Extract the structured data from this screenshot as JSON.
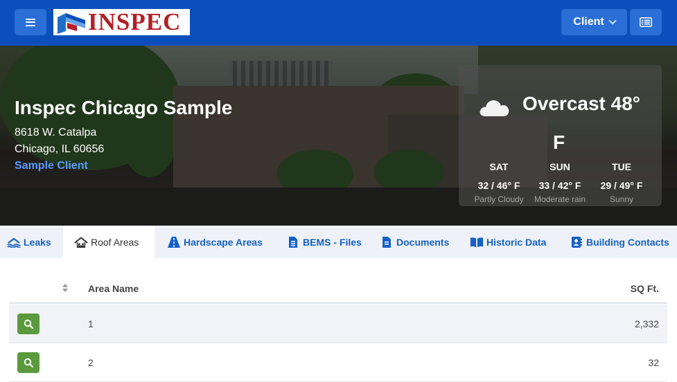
{
  "header": {
    "logo_text": "INSPEC",
    "client_label": "Client"
  },
  "property": {
    "name": "Inspec Chicago Sample",
    "address_line1": "8618 W. Catalpa",
    "address_line2": "Chicago, IL 60656",
    "client": "Sample Client"
  },
  "weather": {
    "current": "Overcast 48°",
    "unit": "F",
    "forecast": [
      {
        "day": "SAT",
        "temps": "32 / 46° F",
        "condition": "Partly Cloudy"
      },
      {
        "day": "SUN",
        "temps": "33 / 42° F",
        "condition": "Moderate rain"
      },
      {
        "day": "TUE",
        "temps": "29 / 49° F",
        "condition": "Sunny"
      }
    ]
  },
  "tabs": [
    {
      "label": "Leaks",
      "icon": "water-icon"
    },
    {
      "label": "Roof Areas",
      "icon": "roof-icon",
      "active": true
    },
    {
      "label": "Hardscape Areas",
      "icon": "road-icon"
    },
    {
      "label": "BEMS - Files",
      "icon": "file-icon"
    },
    {
      "label": "Documents",
      "icon": "document-icon"
    },
    {
      "label": "Historic Data",
      "icon": "book-icon"
    },
    {
      "label": "Building Contacts",
      "icon": "contact-icon"
    }
  ],
  "table": {
    "columns": [
      "Area Name",
      "SQ Ft."
    ],
    "rows": [
      {
        "area_name": "1",
        "sq_ft": "2,332"
      },
      {
        "area_name": "2",
        "sq_ft": "32"
      }
    ]
  },
  "colors": {
    "topbar": "#0b4fbd",
    "button": "#2a6fd6",
    "link": "#1560c8",
    "view_button": "#5a9a3c",
    "logo_red": "#b32025"
  }
}
